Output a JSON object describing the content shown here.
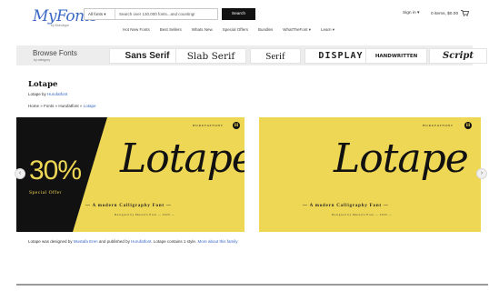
{
  "header": {
    "logo": "MyFonts",
    "logo_sub": "by Monotype",
    "search": {
      "category": "All fonts ▾",
      "placeholder": "Search over 130,000 fonts...and counting!",
      "button": "Search"
    },
    "sign_in": "Sign in ▾",
    "cart": "0 items, $0.00"
  },
  "nav": [
    "Hot New Fonts",
    "Best Sellers",
    "Whats New",
    "Special Offers",
    "Bundles",
    "WhatTheFont ▾",
    "Learn ▾"
  ],
  "browse": {
    "title": "Browse Fonts",
    "subtitle": "by category",
    "categories": {
      "sans_serif": "Sans Serif",
      "slab_serif": "Slab Serif",
      "serif": "Serif",
      "display": "DISPLAY",
      "handwritten": "HANDWRITTEN",
      "script": "Script"
    }
  },
  "page": {
    "title": "Lotape",
    "byline_prefix": "Lotape by",
    "byline_link": "Hurufatfont",
    "breadcrumb": {
      "home": "Home",
      "fonts": "Fonts",
      "foundry": "Hurufatfont",
      "current": "Lotape",
      "separator": "»"
    }
  },
  "slides": {
    "left": {
      "offer_pct": "30%",
      "offer_text": "Special Offer",
      "brand": "HURUFATFONT",
      "brand_mark": "H",
      "font_name": "Lotape",
      "tagline": "— A modern Calligraphy Font —",
      "designed": "Designed by Mustafa Eren — 2020 —"
    },
    "right": {
      "brand": "HURUFATFONT",
      "brand_mark": "H",
      "font_name": "Lotape",
      "tagline": "— A modern Calligraphy Font —",
      "designed": "Designed by Mustafa Eren — 2020 —"
    }
  },
  "arrows": {
    "left": "‹",
    "right": "›"
  },
  "footer": {
    "t1": "Lotape was designed by",
    "designer": "Mustafa Eren",
    "t2": "and published by",
    "publisher": "Hurufatfont",
    "t3": ". Lotape contains 1 style.",
    "more": "More about this family"
  },
  "colors": {
    "accent": "#3a68c4",
    "slide_bg": "#efd756",
    "dark": "#111111",
    "browse_bg": "#ededed"
  }
}
